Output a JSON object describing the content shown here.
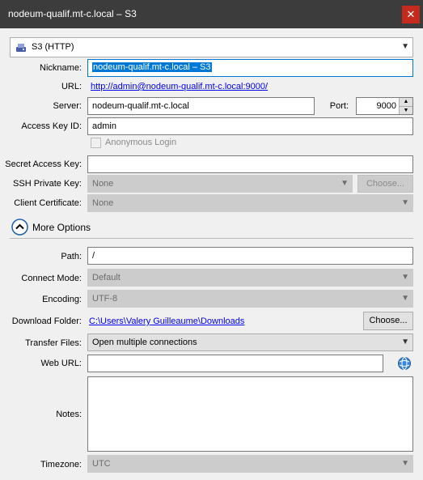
{
  "window": {
    "title": "nodeum-qualif.mt-c.local – S3",
    "close_glyph": "✕"
  },
  "protocol": {
    "value": "S3 (HTTP)"
  },
  "labels": {
    "nickname": "Nickname:",
    "url": "URL:",
    "server": "Server:",
    "port": "Port:",
    "access_key_id": "Access Key ID:",
    "anonymous_login": "Anonymous Login",
    "secret_access_key": "Secret Access Key:",
    "ssh_private_key": "SSH Private Key:",
    "client_certificate": "Client Certificate:",
    "more_options": "More Options",
    "path": "Path:",
    "connect_mode": "Connect Mode:",
    "encoding": "Encoding:",
    "download_folder": "Download Folder:",
    "transfer_files": "Transfer Files:",
    "web_url": "Web URL:",
    "notes": "Notes:",
    "timezone": "Timezone:"
  },
  "values": {
    "nickname": "nodeum-qualif.mt-c.local – S3",
    "url": "http://admin@nodeum-qualif.mt-c.local:9000/",
    "server": "nodeum-qualif.mt-c.local",
    "port": "9000",
    "access_key_id": "admin",
    "secret_access_key": "",
    "ssh_private_key": "None",
    "client_certificate": "None",
    "path": "/",
    "connect_mode": "Default",
    "encoding": "UTF-8",
    "download_folder": "C:\\Users\\Valery Guilleaume\\Downloads",
    "transfer_files": "Open multiple connections",
    "web_url": "",
    "notes": "",
    "timezone": "UTC"
  },
  "buttons": {
    "ssh_choose": "Choose...",
    "download_choose": "Choose..."
  },
  "icons": {
    "drive": "drive-icon",
    "chevron_up": "chevron-up-icon",
    "globe": "globe-icon",
    "dropdown": "chevron-down-icon"
  },
  "colors": {
    "titlebar": "#3c3c3c",
    "close": "#c42b1c",
    "selection": "#0078d7",
    "link": "#0000ee"
  }
}
